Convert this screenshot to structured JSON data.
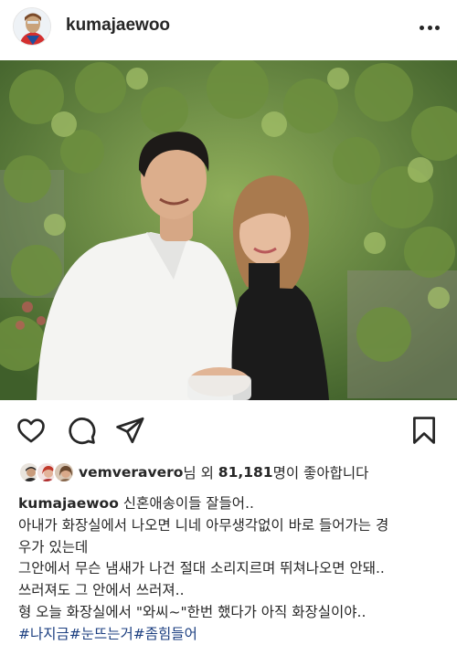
{
  "header": {
    "username": "kumajaewoo",
    "more_icon": "more-horizontal-icon"
  },
  "photo": {
    "icon": "post-photo"
  },
  "actions": {
    "icons": [
      "heart-icon",
      "comment-icon",
      "share-icon",
      "bookmark-icon"
    ]
  },
  "likes": {
    "liker": "vemveravero",
    "middle": "님 외 ",
    "count": "81,181",
    "suffix": "명이 좋아합니다"
  },
  "caption": {
    "author": "kumajaewoo",
    "lines": [
      "신혼애송이들 잘들어..",
      "아내가 화장실에서 나오면 니네 아무생각없이 바로 들어가는 경",
      "우가 있는데",
      "그안에서 무슨 냄새가 나건 절대 소리지르며 뛰쳐나오면 안돼..",
      "쓰러져도 그 안에서 쓰러져..",
      "형 오늘 화장실에서 \"와씨~\"한번 했다가 아직 화장실이야.."
    ],
    "hashtags": "#나지금#눈뜨는거#좀힘들어"
  },
  "colors": {
    "text": "#262626",
    "hashtag": "#1c3f80",
    "background": "#ffffff"
  }
}
